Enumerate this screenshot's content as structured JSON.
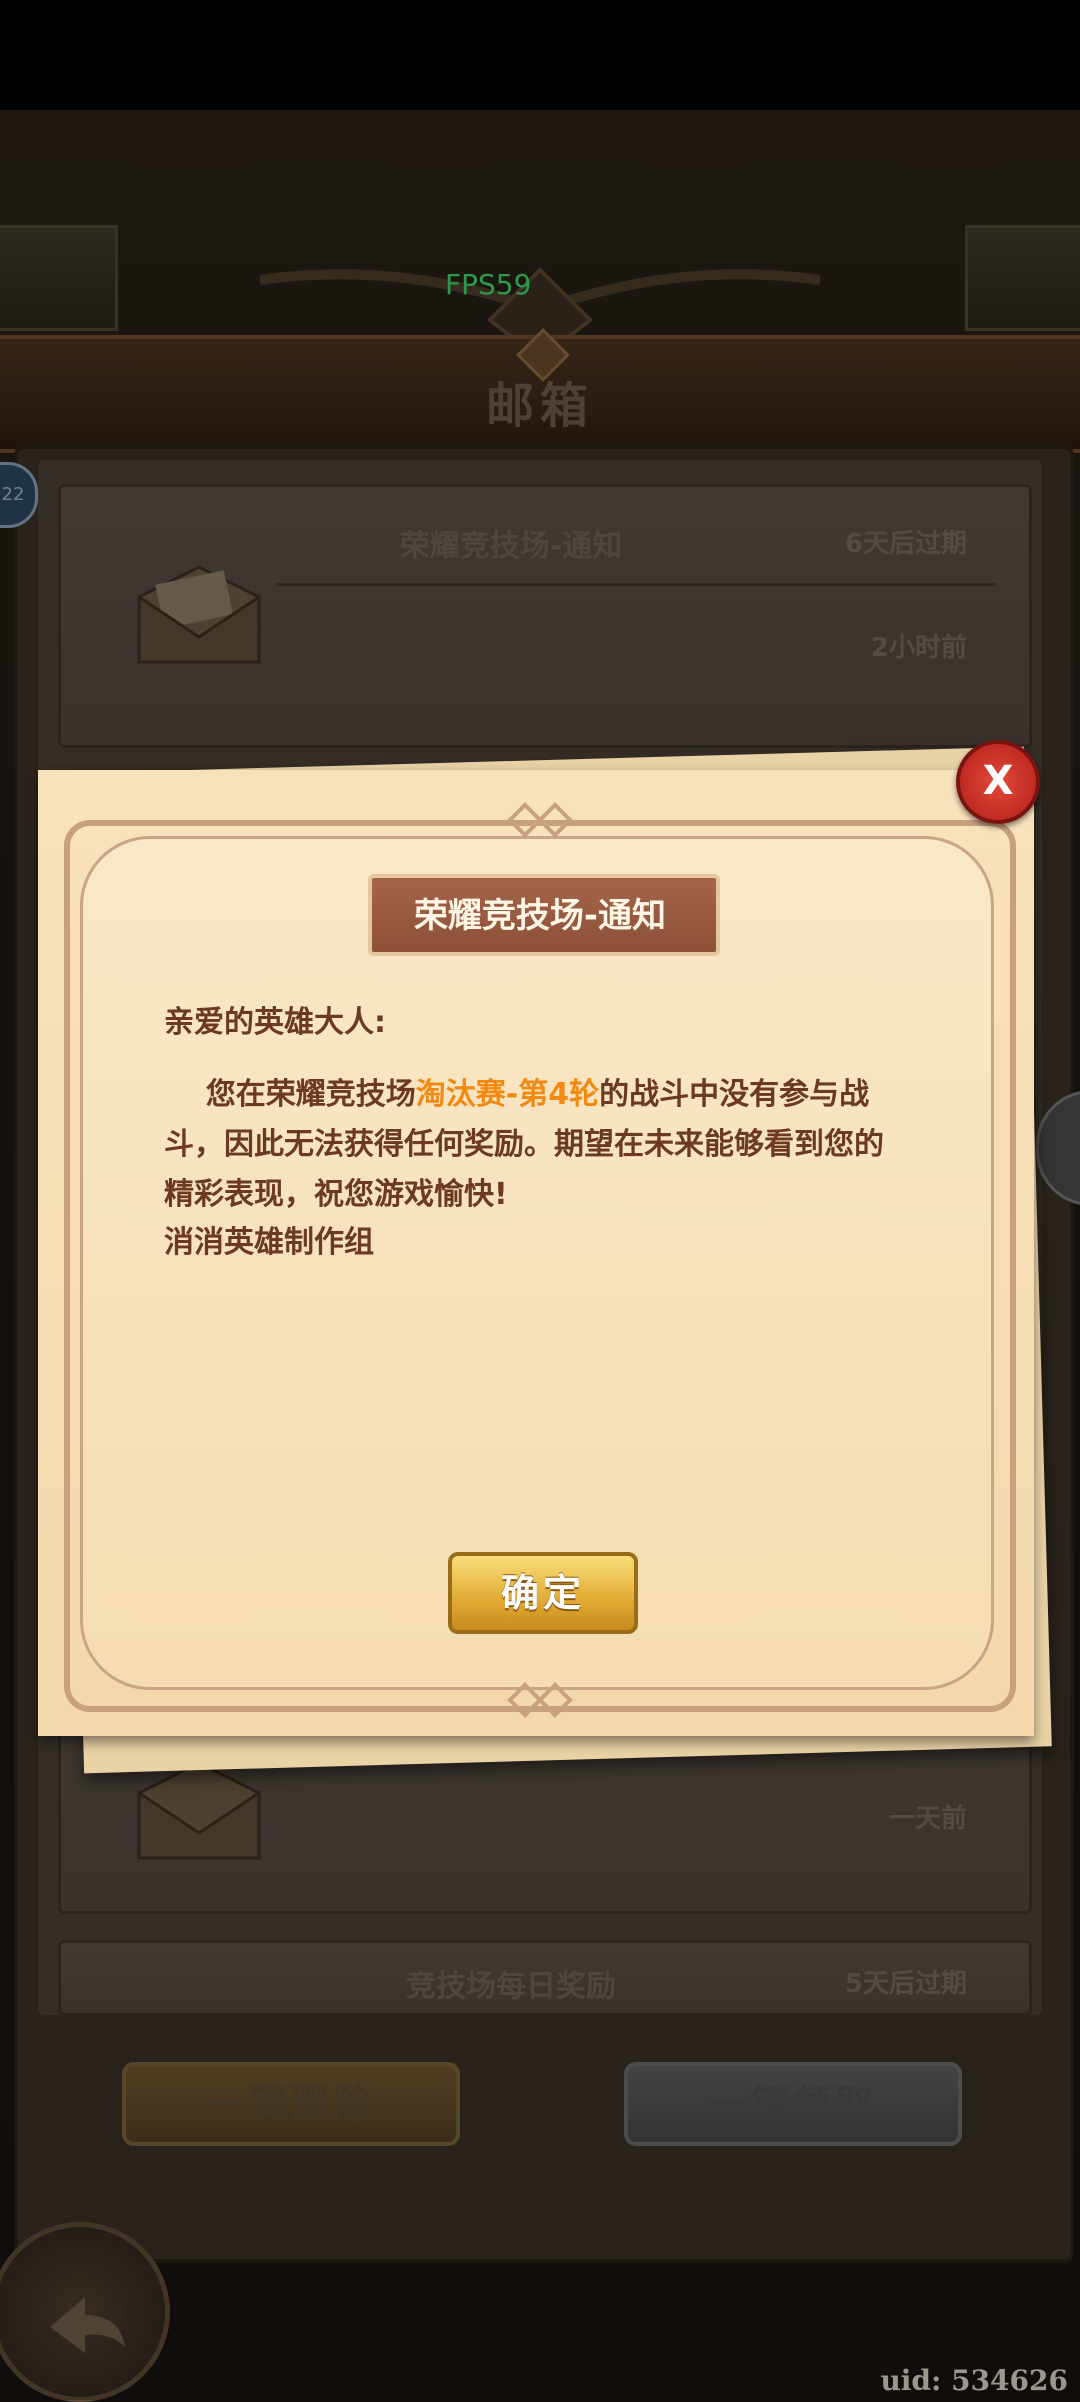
{
  "hud": {
    "fps": "FPS59",
    "uid": "uid: 534626",
    "left_badge": "22"
  },
  "header": {
    "title": "邮箱"
  },
  "mail_list": [
    {
      "title": "荣耀竞技场-通知",
      "expire": "6天后过期",
      "time": "2小时前"
    },
    {
      "title": "",
      "expire": "",
      "time": "一天前"
    },
    {
      "title": "竞技场每日奖励",
      "expire": "5天后过期",
      "time": ""
    }
  ],
  "footer": {
    "delete_all": "一键删除",
    "claim_all": "一键领取"
  },
  "modal": {
    "title": "荣耀竞技场-通知",
    "greeting": "亲爱的英雄大人:",
    "body_before": "您在荣耀竞技场",
    "body_highlight": "淘汰赛-第4轮",
    "body_after": "的战斗中没有参与战斗，因此无法获得任何奖励。期望在未来能够看到您的精彩表现，祝您游戏愉快!",
    "signature": "消消英雄制作组",
    "confirm": "确定",
    "close": "X"
  },
  "colors": {
    "highlight": "#f28a12",
    "text": "#6b3a20",
    "confirm": "#e1ab33",
    "close": "#d2352a"
  }
}
